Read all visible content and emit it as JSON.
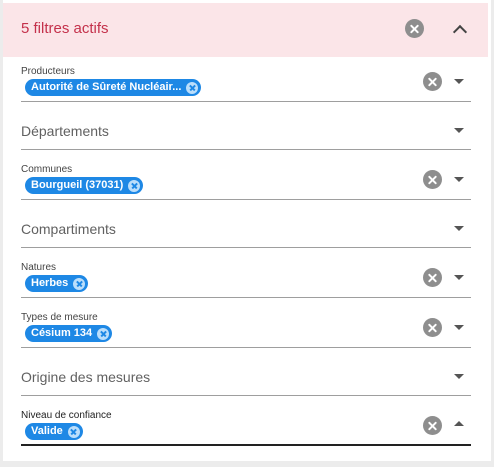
{
  "header": {
    "title": "5 filtres actifs"
  },
  "filters": [
    {
      "label": "Producteurs",
      "value": "Autorité de Sûreté Nucléair..."
    },
    {
      "label": "Départements"
    },
    {
      "label": "Communes",
      "value": "Bourgueil (37031)"
    },
    {
      "label": "Compartiments"
    },
    {
      "label": "Natures",
      "value": "Herbes"
    },
    {
      "label": "Types de mesure",
      "value": "Césium 134"
    },
    {
      "label": "Origine des mesures"
    },
    {
      "label": "Niveau de confiance",
      "value": "Valide"
    }
  ],
  "colors": {
    "header_bg": "#fbe5e8",
    "header_text": "#c4314b",
    "chip_bg": "#1e88e5"
  }
}
